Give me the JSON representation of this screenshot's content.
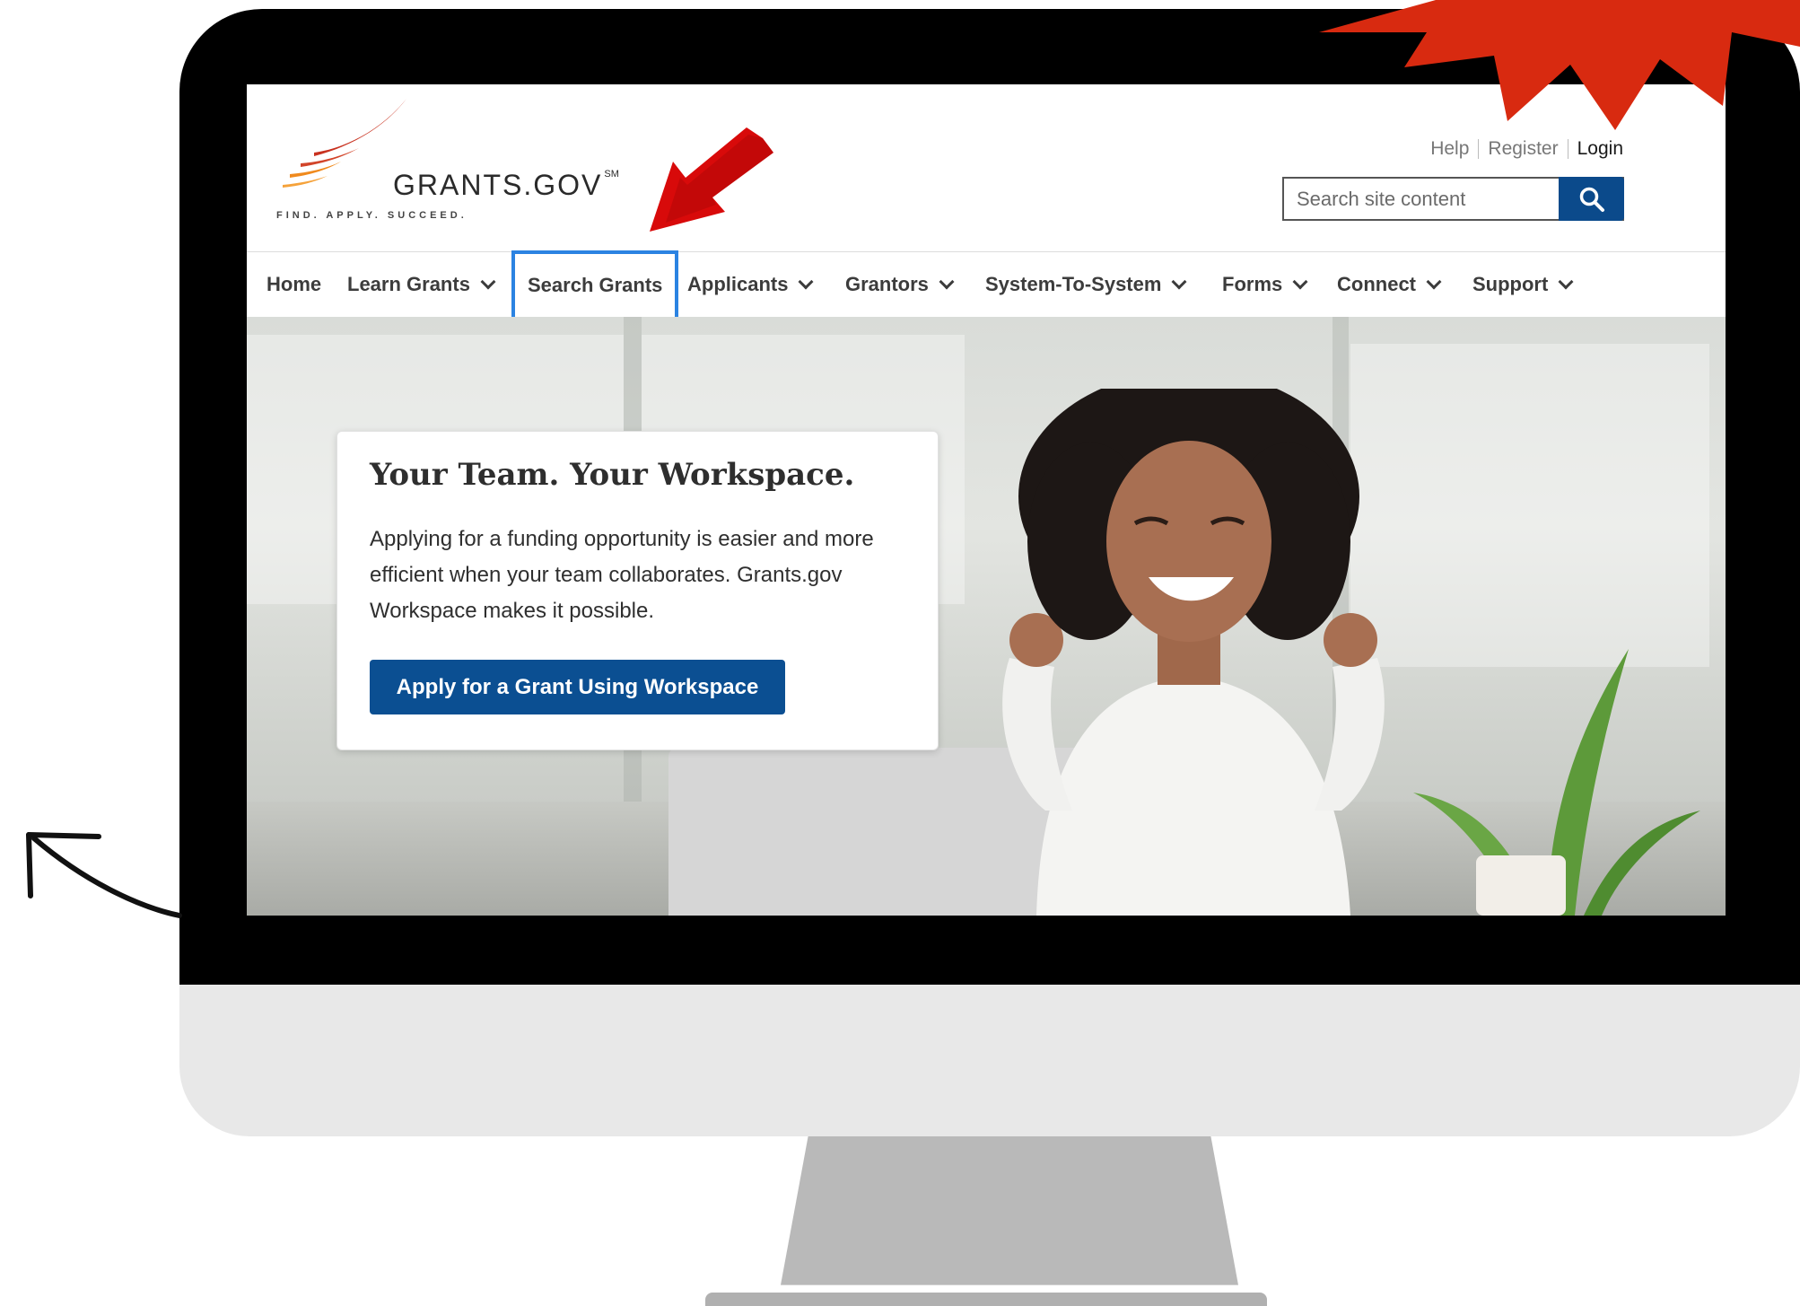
{
  "site": {
    "logo_name": "GRANTS.GOV",
    "logo_sm": "SM",
    "tagline": "FIND. APPLY. SUCCEED.",
    "brand_red": "#c8311f",
    "brand_orange": "#f08a1d"
  },
  "utility_links": {
    "help": "Help",
    "register": "Register",
    "login": "Login"
  },
  "search": {
    "placeholder": "Search site content",
    "button_icon": "search-icon",
    "button_color": "#0b4a8b"
  },
  "nav": {
    "home": "Home",
    "learn_grants": "Learn Grants",
    "search_grants": "Search Grants",
    "applicants": "Applicants",
    "grantors": "Grantors",
    "system_to_system": "System-To-System",
    "forms": "Forms",
    "connect": "Connect",
    "support": "Support",
    "active_item": "Search Grants",
    "active_outline_color": "#2b83e2"
  },
  "hero": {
    "title": "Your Team. Your Workspace.",
    "body": "Applying for a funding opportunity is easier and more efficient when your team collaborates. Grants.gov Workspace makes it possible.",
    "cta": "Apply for a Grant Using Workspace",
    "cta_color": "#0b4f92"
  },
  "annotations": {
    "burst_color": "#d82a10",
    "pointer_arrow_color": "#d80a0a",
    "pointer_arrow_target": "Search Grants"
  }
}
